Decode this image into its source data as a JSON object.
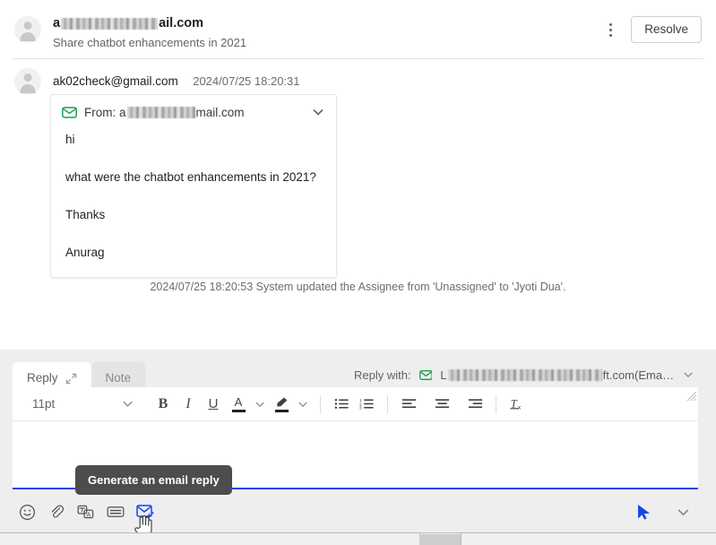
{
  "header": {
    "title_suffix": "ail.com",
    "subject": "Share chatbot enhancements in 2021",
    "resolve_label": "Resolve",
    "kebab_name": "more-options"
  },
  "message": {
    "from": "ak02check@gmail.com",
    "timestamp": "2024/07/25 18:20:31",
    "card": {
      "from_label": "From:",
      "from_prefix": "a",
      "from_suffix": "mail.com",
      "lines": [
        "hi",
        "what were the chatbot enhancements in 2021?"
      ],
      "signature_line1": "Thanks",
      "signature_line2": "Anurag"
    }
  },
  "system_event": "2024/07/25 18:20:53 System updated the Assignee from 'Unassigned' to 'Jyoti Dua'.",
  "composer": {
    "tabs": [
      {
        "label": "Reply",
        "active": true
      },
      {
        "label": "Note",
        "active": false
      }
    ],
    "reply_with": {
      "label": "Reply with:",
      "value_prefix": "L",
      "value_suffix": "ft.com(Ema…"
    },
    "toolbar": {
      "font_size": "11pt",
      "bold": "B",
      "italic": "I",
      "underline": "U",
      "text_color": "A",
      "highlight": "highlighter",
      "bullet_list": "bulleted-list",
      "numbered_list": "numbered-list",
      "align_left": "align-left",
      "align_center": "align-center",
      "align_right": "align-right",
      "clear_format": "clear-formatting"
    },
    "body_text": "",
    "tooltip": "Generate an email reply",
    "bottom_icons": [
      "emoji-icon",
      "attachment-icon",
      "translate-icon",
      "canned-response-icon",
      "generate-email-reply-icon"
    ],
    "send_icon": "send-icon",
    "send_options_icon": "chevron-down-icon"
  },
  "colors": {
    "accent_blue": "#1a46e8",
    "envelope_green": "#15a04a",
    "tooltip_bg": "#4d4d4d",
    "composer_bg": "#eeeeee"
  }
}
